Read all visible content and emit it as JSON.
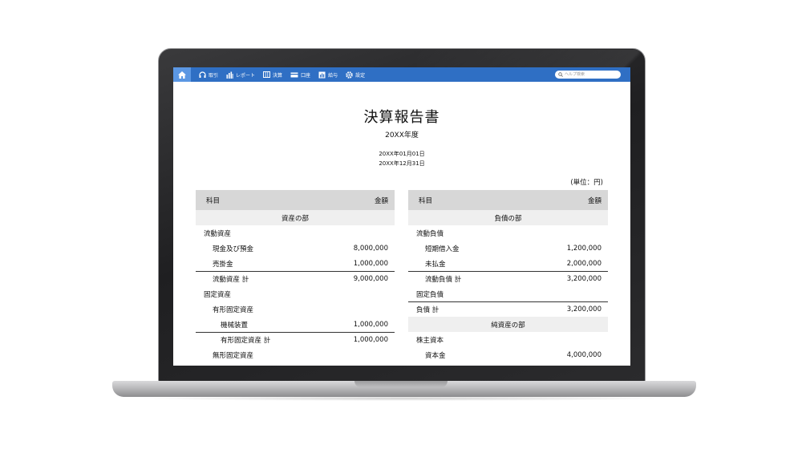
{
  "toolbar": {
    "items": [
      {
        "label": "取引",
        "icon": "headset-icon"
      },
      {
        "label": "レポート",
        "icon": "bar-chart-icon"
      },
      {
        "label": "決算",
        "icon": "ledger-icon"
      },
      {
        "label": "口座",
        "icon": "card-icon"
      },
      {
        "label": "給与",
        "icon": "payroll-icon"
      },
      {
        "label": "設定",
        "icon": "gear-icon"
      }
    ],
    "search_placeholder": "ヘルプ検索"
  },
  "report": {
    "title": "決算報告書",
    "fiscal_year": "20XX年度",
    "period_start": "20XX年01月01日",
    "period_end": "20XX年12月31日",
    "unit": "(単位：円)"
  },
  "assets": {
    "header": {
      "account": "科目",
      "amount": "金額"
    },
    "rows": [
      {
        "label": "資産の部",
        "amount": "",
        "type": "section",
        "indent": 0
      },
      {
        "label": "流動資産",
        "amount": "",
        "type": "group",
        "indent": 0
      },
      {
        "label": "現金及び預金",
        "amount": "8,000,000",
        "type": "item",
        "indent": 1
      },
      {
        "label": "売掛金",
        "amount": "1,000,000",
        "type": "item",
        "indent": 1
      },
      {
        "label": "流動資産 計",
        "amount": "9,000,000",
        "type": "total",
        "indent": 1
      },
      {
        "label": "固定資産",
        "amount": "",
        "type": "group",
        "indent": 0
      },
      {
        "label": "有形固定資産",
        "amount": "",
        "type": "group",
        "indent": 1
      },
      {
        "label": "機械装置",
        "amount": "1,000,000",
        "type": "item",
        "indent": 2
      },
      {
        "label": "有形固定資産 計",
        "amount": "1,000,000",
        "type": "total",
        "indent": 2
      },
      {
        "label": "無形固定資産",
        "amount": "",
        "type": "group",
        "indent": 1
      }
    ]
  },
  "liabilities": {
    "header": {
      "account": "科目",
      "amount": "金額"
    },
    "rows": [
      {
        "label": "負債の部",
        "amount": "",
        "type": "section",
        "indent": 0
      },
      {
        "label": "流動負債",
        "amount": "",
        "type": "group",
        "indent": 0
      },
      {
        "label": "短期借入金",
        "amount": "1,200,000",
        "type": "item",
        "indent": 1
      },
      {
        "label": "未払金",
        "amount": "2,000,000",
        "type": "item",
        "indent": 1
      },
      {
        "label": "流動負債 計",
        "amount": "3,200,000",
        "type": "total",
        "indent": 1
      },
      {
        "label": "固定負債",
        "amount": "",
        "type": "group",
        "indent": 0
      },
      {
        "label": "負債 計",
        "amount": "3,200,000",
        "type": "total",
        "indent": 0
      },
      {
        "label": "純資産の部",
        "amount": "",
        "type": "section",
        "indent": 0
      },
      {
        "label": "株主資本",
        "amount": "",
        "type": "group",
        "indent": 0
      },
      {
        "label": "資本金",
        "amount": "4,000,000",
        "type": "item",
        "indent": 1
      }
    ]
  },
  "colors": {
    "toolbar": "#2f6fc4",
    "home_active": "#5b97e3",
    "table_header": "#d7d7d7",
    "section_row": "#efefef"
  }
}
